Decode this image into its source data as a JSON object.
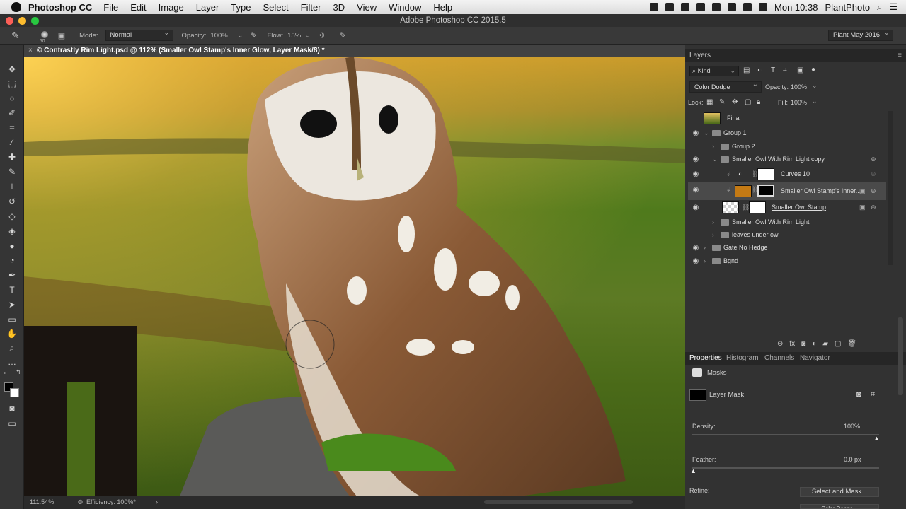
{
  "menubar": {
    "app": "Photoshop CC",
    "items": [
      "File",
      "Edit",
      "Image",
      "Layer",
      "Type",
      "Select",
      "Filter",
      "3D",
      "View",
      "Window",
      "Help"
    ],
    "clock": "Mon 10:38",
    "user": "PlantPhoto"
  },
  "titlebar": {
    "title": "Adobe Photoshop CC 2015.5"
  },
  "options": {
    "brush_size": "50",
    "mode_label": "Mode:",
    "mode_value": "Normal",
    "opacity_label": "Opacity:",
    "opacity_value": "100%",
    "flow_label": "Flow:",
    "flow_value": "15%",
    "workspace": "Plant May 2016"
  },
  "document": {
    "tab_title": "© Contrastly Rim Light.psd @ 112% (Smaller Owl Stamp's Inner Glow, Layer Mask/8) *",
    "close": "×"
  },
  "status": {
    "zoom": "111.54%",
    "efficiency": "Efficiency: 100%*"
  },
  "layers_panel": {
    "title": "Layers",
    "kind": "Kind",
    "blend_mode": "Color Dodge",
    "opacity_label": "Opacity:",
    "opacity_value": "100%",
    "lock_label": "Lock:",
    "fill_label": "Fill:",
    "fill_value": "100%",
    "layers": [
      "Final",
      "Group 1",
      "Group 2",
      "Smaller Owl With Rim Light copy",
      "Curves 10",
      "Smaller Owl Stamp's Inner...",
      "Smaller Owl Stamp",
      "Smaller Owl With Rim Light",
      "leaves under owl",
      "Gate No Hedge",
      "Bgnd"
    ]
  },
  "properties_panel": {
    "tabs": [
      "Properties",
      "Histogram",
      "Channels",
      "Navigator"
    ],
    "section": "Masks",
    "mask_name": "Layer Mask",
    "density_label": "Density:",
    "density_value": "100%",
    "feather_label": "Feather:",
    "feather_value": "0.0 px",
    "refine_label": "Refine:",
    "select_mask_button": "Select and Mask...",
    "color_range_button": "Color Range..."
  },
  "colors": {
    "accent": "#5b8fd6",
    "mask_thumb_orange": "#c47a14"
  }
}
